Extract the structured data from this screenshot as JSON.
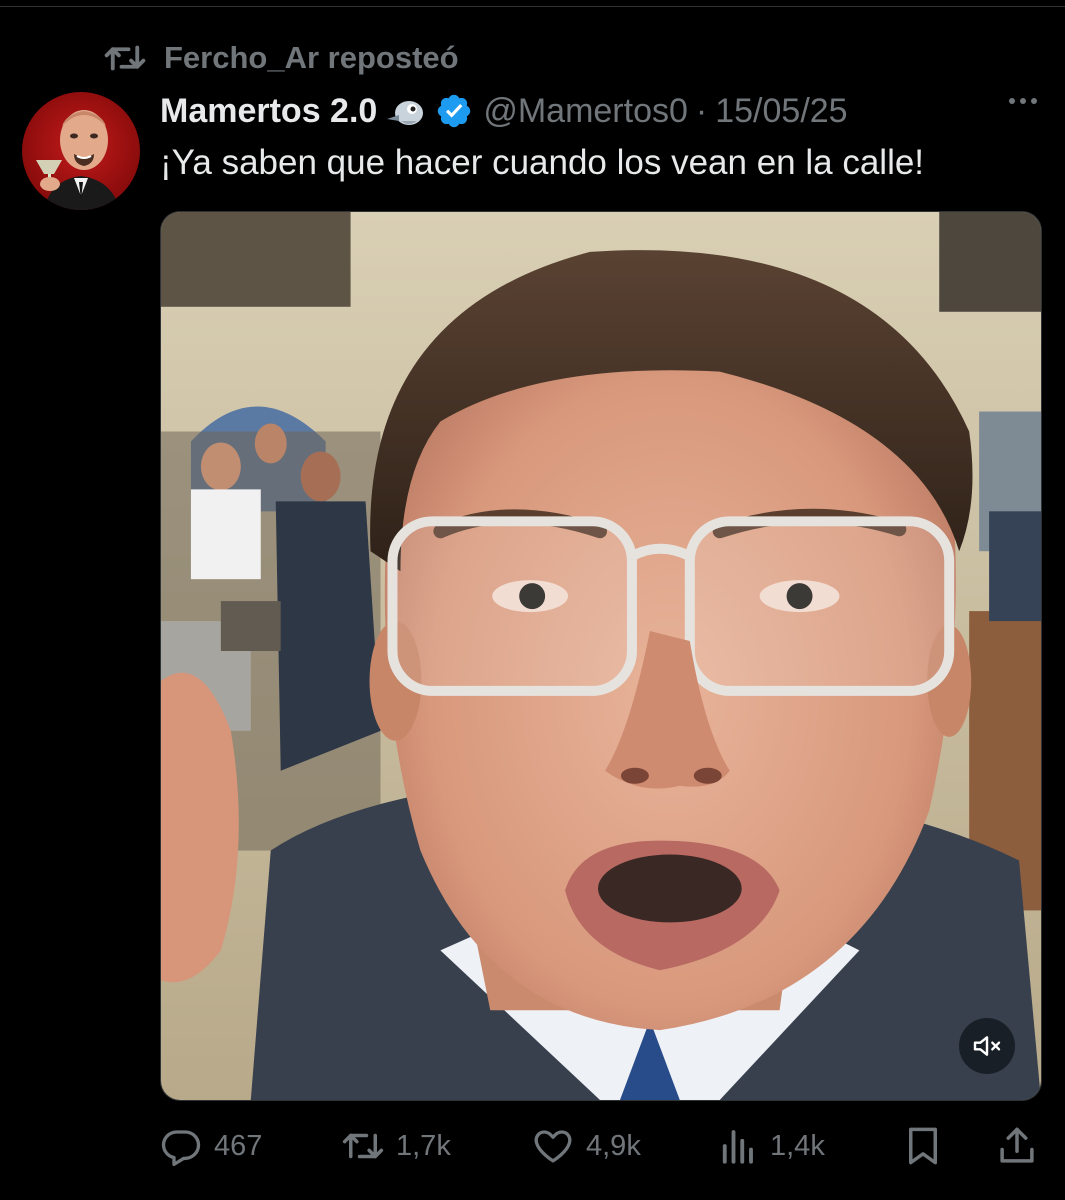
{
  "repost": {
    "icon": "repost-icon",
    "text": "Fercho_Ar reposteó"
  },
  "tweet": {
    "avatar": "avatar",
    "display_name": "Mamertos 2.0",
    "emoji": "bird-emoji",
    "verified": "verified-badge-icon",
    "handle": "@Mamertos0",
    "separator": "·",
    "date": "15/05/25",
    "text": "¡Ya saben que hacer cuando los vean en la calle!",
    "media": {
      "type": "video",
      "muted": true
    }
  },
  "actions": {
    "reply_count": "467",
    "repost_count": "1,7k",
    "like_count": "4,9k",
    "view_count": "1,4k"
  },
  "colors": {
    "background": "#000000",
    "text_primary": "#e7e9ea",
    "text_secondary": "#71767b",
    "verified_blue": "#1d9bf0"
  }
}
